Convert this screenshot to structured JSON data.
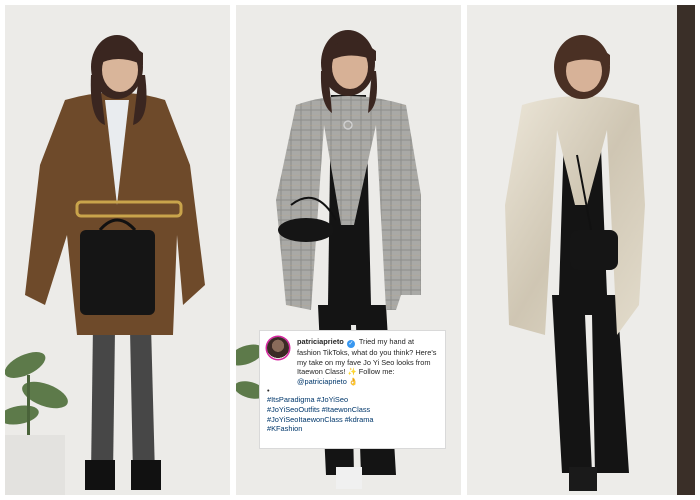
{
  "caption": {
    "username": "patriciaprieto",
    "text": "Tried my hand at fashion TikToks, what do you think? Here's my take on my fave Jo Yi Seo looks from Itaewon Class! ✨ Follow me: ",
    "mention": "@patriciaprieto",
    "emoji_end": "👌",
    "separator": "•",
    "tags_line1": "#ItsParadigma #JoYiSeo",
    "tags_line2": "#JoYiSeoOutfits #ItaewonClass",
    "tags_line3": "#JoYiSeoItaewonClass #kdrama",
    "tags_line4": "#KFashion"
  },
  "icons": [
    "verified-badge-icon",
    "sparkles-icon",
    "ok-hand-icon"
  ],
  "colors": {
    "background": "#eeeeec",
    "brown_blazer": "#6e4a2a",
    "plaid_blazer": "#a9a9a6",
    "metallic_blazer": "#d9d2c3",
    "black": "#141414",
    "hashtag": "#00376b"
  }
}
